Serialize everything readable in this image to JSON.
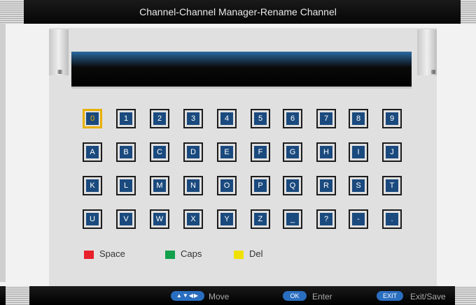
{
  "title": "Channel-Channel Manager-Rename Channel",
  "input_value": "",
  "keys": [
    [
      "0",
      "1",
      "2",
      "3",
      "4",
      "5",
      "6",
      "7",
      "8",
      "9"
    ],
    [
      "A",
      "B",
      "C",
      "D",
      "E",
      "F",
      "G",
      "H",
      "I",
      "J"
    ],
    [
      "K",
      "L",
      "M",
      "N",
      "O",
      "P",
      "Q",
      "R",
      "S",
      "T"
    ],
    [
      "U",
      "V",
      "W",
      "X",
      "Y",
      "Z",
      "_",
      "?",
      "-",
      "."
    ]
  ],
  "selected_key": "0",
  "legend": [
    {
      "label": "Space",
      "color": "#e8202a"
    },
    {
      "label": "Caps",
      "color": "#12a04a"
    },
    {
      "label": "Del",
      "color": "#f0e000"
    }
  ],
  "hints": {
    "arrows": "▲▼◀▶",
    "move": "Move",
    "ok_pill": "OK",
    "enter": "Enter",
    "exit_pill": "EXIT",
    "exit_save": "Exit/Save"
  },
  "frame_tick": "IIIII"
}
